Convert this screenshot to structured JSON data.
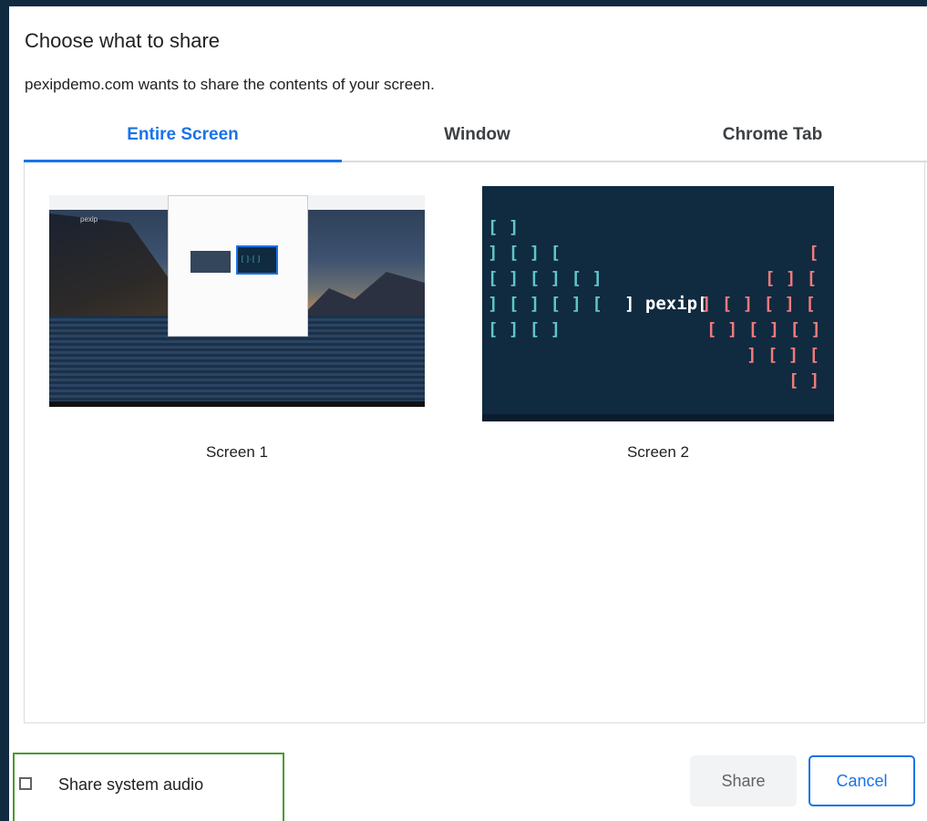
{
  "dialog": {
    "title": "Choose what to share",
    "subtitle": "pexipdemo.com wants to share the contents of your screen."
  },
  "tabs": [
    {
      "label": "Entire Screen",
      "active": true
    },
    {
      "label": "Window",
      "active": false
    },
    {
      "label": "Chrome Tab",
      "active": false
    }
  ],
  "sources": [
    {
      "label": "Screen 1",
      "thumbnail_text": "pexip"
    },
    {
      "label": "Screen 2",
      "thumbnail_text": "pexip"
    }
  ],
  "footer": {
    "audio_label": "Share system audio",
    "audio_checked": false,
    "share_label": "Share",
    "cancel_label": "Cancel"
  },
  "colors": {
    "accent": "#1a73e8",
    "backdrop": "#102a40",
    "highlight_outline": "#4a9a2c",
    "brand_teal": "#5ec6c9",
    "brand_coral": "#f07b7b"
  }
}
